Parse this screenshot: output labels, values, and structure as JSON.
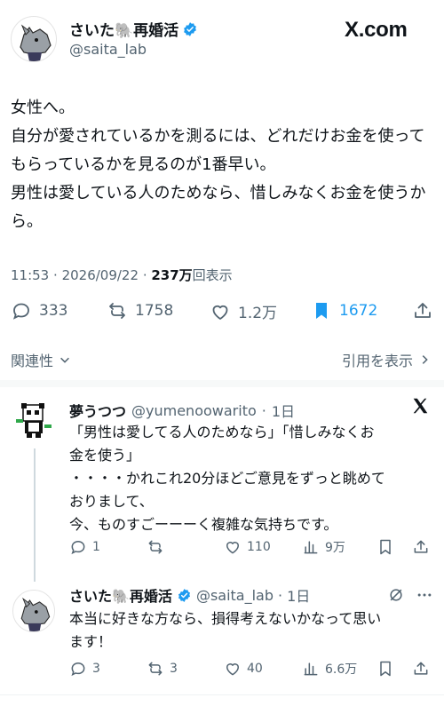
{
  "header": {
    "display_name": "さいた🐘再婚活",
    "handle": "@saita_lab",
    "site": "X.com"
  },
  "post": {
    "text": "女性へ。\n自分が愛されているかを測るには、どれだけお金を使ってもらっているかを見るのが1番早い。\n男性は愛している人のためなら、惜しみなくお金を使うから。",
    "time": "11:53",
    "date": "2026/09/22",
    "views_count": "237万",
    "views_label": "回表示",
    "replies": "333",
    "reposts": "1758",
    "likes": "1.2万",
    "bookmarks": "1672"
  },
  "filters": {
    "relevance_label": "関連性",
    "quotes_label": "引用を表示"
  },
  "replies": [
    {
      "name": "夢うつつ",
      "handle": "@yumenoowarito",
      "age": "1日",
      "text": "「男性は愛してる人のためなら」「惜しみなくお\n金を使う」\n・・・・かれこれ20分ほどご意見をずっと眺めて\nおりまして、\n今、ものすごーーーく複雑な気持ちです。",
      "replies": "1",
      "reposts": "",
      "likes": "110",
      "views": "9万"
    },
    {
      "name": "さいた🐘再婚活",
      "handle": "@saita_lab",
      "age": "1日",
      "text": "本当に好きな方なら、損得考えないかなって思い\nます！",
      "replies": "3",
      "reposts": "3",
      "likes": "40",
      "views": "6.6万"
    }
  ],
  "colors": {
    "accent": "#1d9bf0",
    "text": "#0f1419",
    "muted": "#536471"
  }
}
